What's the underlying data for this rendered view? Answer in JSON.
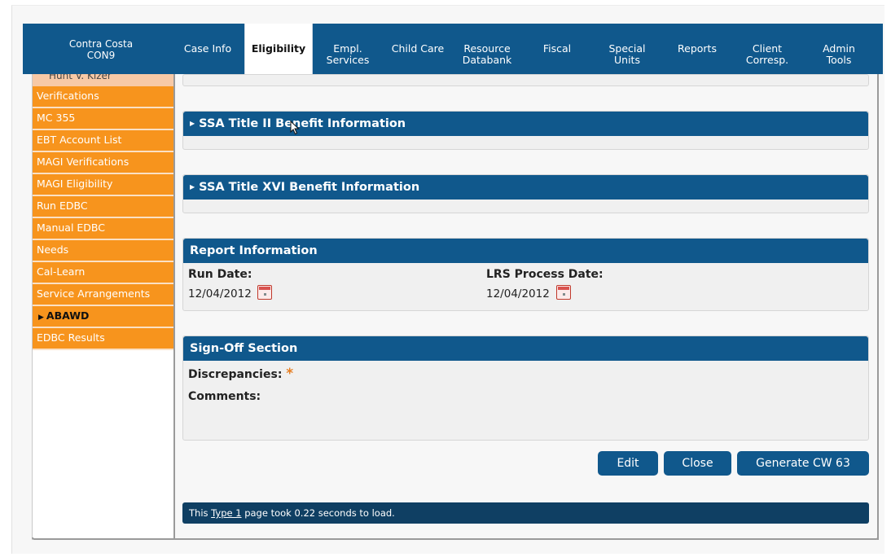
{
  "header": {
    "county_name": "Contra Costa",
    "county_code": "CON9"
  },
  "nav": {
    "tabs": [
      {
        "line1": "Case Info",
        "line2": ""
      },
      {
        "line1": "Eligibility",
        "line2": ""
      },
      {
        "line1": "Empl.",
        "line2": "Services"
      },
      {
        "line1": "Child Care",
        "line2": ""
      },
      {
        "line1": "Resource",
        "line2": "Databank"
      },
      {
        "line1": "Fiscal",
        "line2": ""
      },
      {
        "line1": "Special",
        "line2": "Units"
      },
      {
        "line1": "Reports",
        "line2": ""
      },
      {
        "line1": "Client",
        "line2": "Corresp."
      },
      {
        "line1": "Admin",
        "line2": "Tools"
      }
    ]
  },
  "sidebar": {
    "top_partial": "Hunt V. Kizer",
    "items": [
      {
        "label": "Verifications"
      },
      {
        "label": "MC 355"
      },
      {
        "label": "EBT Account List"
      },
      {
        "label": "MAGI Verifications"
      },
      {
        "label": "MAGI Eligibility"
      },
      {
        "label": "Run EDBC"
      },
      {
        "label": "Manual EDBC"
      },
      {
        "label": "Needs"
      },
      {
        "label": "Cal-Learn"
      },
      {
        "label": "Service Arrangements"
      },
      {
        "label": "ABAWD"
      },
      {
        "label": "EDBC Results"
      }
    ],
    "current_index": 10
  },
  "sections": {
    "ssa_title2": "SSA Title II Benefit Information",
    "ssa_title16": "SSA Title XVI Benefit Information",
    "report": {
      "title": "Report Information",
      "run_date_label": "Run Date:",
      "run_date_value": "12/04/2012",
      "lrs_date_label": "LRS Process Date:",
      "lrs_date_value": "12/04/2012"
    },
    "signoff": {
      "title": "Sign-Off Section",
      "discrepancies_label": "Discrepancies:",
      "required_mark": "*",
      "comments_label": "Comments:"
    }
  },
  "actions": {
    "edit": "Edit",
    "close": "Close",
    "generate": "Generate CW 63"
  },
  "footer": {
    "prefix": "This",
    "link": "Type 1",
    "suffix": "page took 0.22 seconds to load."
  }
}
